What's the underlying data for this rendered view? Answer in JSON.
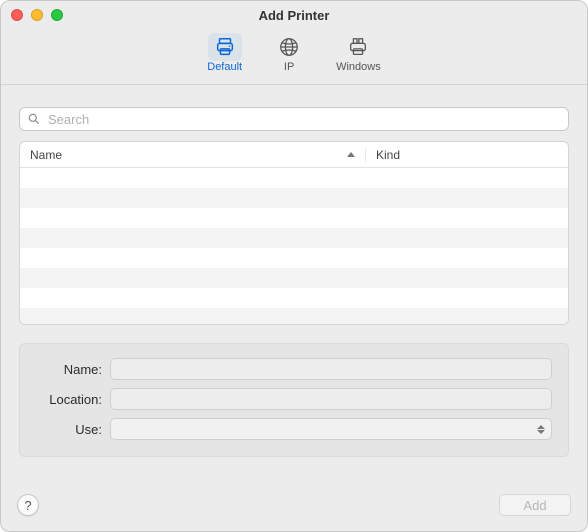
{
  "window": {
    "title": "Add Printer"
  },
  "toolbar": {
    "tabs": [
      {
        "label": "Default",
        "icon": "printer-icon",
        "selected": true
      },
      {
        "label": "IP",
        "icon": "globe-icon",
        "selected": false
      },
      {
        "label": "Windows",
        "icon": "windows-printer-icon",
        "selected": false
      }
    ]
  },
  "search": {
    "placeholder": "Search",
    "value": ""
  },
  "table": {
    "columns": [
      {
        "label": "Name",
        "sortable": true,
        "sort": "asc"
      },
      {
        "label": "Kind",
        "sortable": false
      }
    ],
    "rows": []
  },
  "form": {
    "name_label": "Name:",
    "name_value": "",
    "location_label": "Location:",
    "location_value": "",
    "use_label": "Use:",
    "use_value": ""
  },
  "footer": {
    "help_label": "?",
    "add_label": "Add",
    "add_enabled": false
  }
}
